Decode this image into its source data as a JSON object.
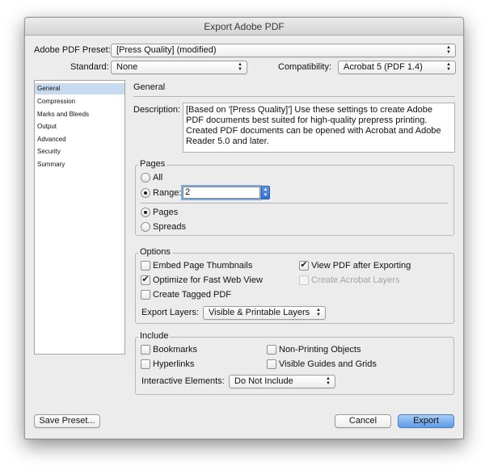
{
  "window": {
    "title": "Export Adobe PDF"
  },
  "preset": {
    "label": "Adobe PDF Preset:",
    "value": "[Press Quality] (modified)"
  },
  "standard": {
    "label": "Standard:",
    "value": "None"
  },
  "compatibility": {
    "label": "Compatibility:",
    "value": "Acrobat 5 (PDF 1.4)"
  },
  "sidebar": {
    "items": [
      {
        "label": "General",
        "selected": true
      },
      {
        "label": "Compression",
        "selected": false
      },
      {
        "label": "Marks and Bleeds",
        "selected": false
      },
      {
        "label": "Output",
        "selected": false
      },
      {
        "label": "Advanced",
        "selected": false
      },
      {
        "label": "Security",
        "selected": false
      },
      {
        "label": "Summary",
        "selected": false
      }
    ]
  },
  "general": {
    "header": "General",
    "description_label": "Description:",
    "description": "[Based on '[Press Quality]'] Use these settings to create Adobe PDF documents best suited for high-quality prepress printing. Created PDF documents can be opened with Acrobat and Adobe Reader 5.0 and later."
  },
  "pages": {
    "title": "Pages",
    "all_label": "All",
    "range_label": "Range:",
    "range_value": "2",
    "pages_label": "Pages",
    "spreads_label": "Spreads",
    "range_mode": "Range",
    "layout_mode": "Pages"
  },
  "options": {
    "title": "Options",
    "embed_thumbnails": {
      "label": "Embed Page Thumbnails",
      "checked": false
    },
    "optimize_web": {
      "label": "Optimize for Fast Web View",
      "checked": true
    },
    "tagged_pdf": {
      "label": "Create Tagged PDF",
      "checked": false
    },
    "view_after": {
      "label": "View PDF after Exporting",
      "checked": true
    },
    "acrobat_layers": {
      "label": "Create Acrobat Layers",
      "checked": false,
      "disabled": true
    },
    "export_layers_label": "Export Layers:",
    "export_layers_value": "Visible & Printable Layers"
  },
  "include": {
    "title": "Include",
    "bookmarks": {
      "label": "Bookmarks",
      "checked": false
    },
    "hyperlinks": {
      "label": "Hyperlinks",
      "checked": false
    },
    "non_printing": {
      "label": "Non-Printing Objects",
      "checked": false
    },
    "guides_grids": {
      "label": "Visible Guides and Grids",
      "checked": false
    },
    "interactive_label": "Interactive Elements:",
    "interactive_value": "Do Not Include"
  },
  "buttons": {
    "save_preset": "Save Preset...",
    "cancel": "Cancel",
    "export": "Export"
  },
  "colors": {
    "selection": "#c8daf0",
    "primary_button": "#5d9be8",
    "window_bg": "#ececec"
  }
}
